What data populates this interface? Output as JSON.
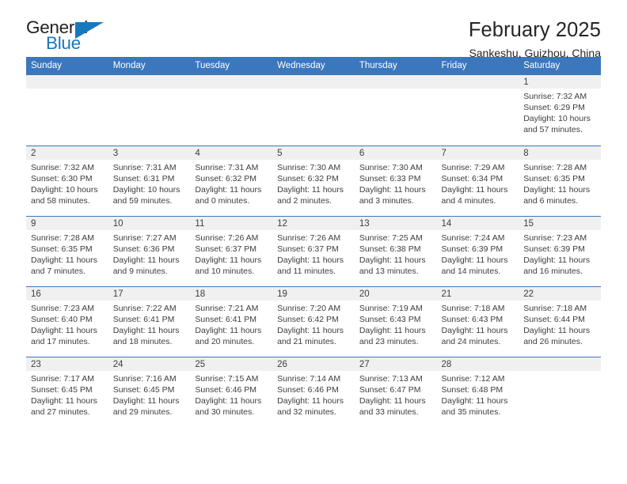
{
  "brand": {
    "name_part1": "General",
    "name_part2": "Blue",
    "accent_color": "#1878be"
  },
  "header": {
    "month_title": "February 2025",
    "location": "Sankeshu, Guizhou, China"
  },
  "calendar": {
    "header_bg": "#3b77bc",
    "weekdays": [
      "Sunday",
      "Monday",
      "Tuesday",
      "Wednesday",
      "Thursday",
      "Friday",
      "Saturday"
    ],
    "weeks": [
      [
        {
          "empty": true
        },
        {
          "empty": true
        },
        {
          "empty": true
        },
        {
          "empty": true
        },
        {
          "empty": true
        },
        {
          "empty": true
        },
        {
          "day": "1",
          "sunrise": "Sunrise: 7:32 AM",
          "sunset": "Sunset: 6:29 PM",
          "daylight": "Daylight: 10 hours and 57 minutes."
        }
      ],
      [
        {
          "day": "2",
          "sunrise": "Sunrise: 7:32 AM",
          "sunset": "Sunset: 6:30 PM",
          "daylight": "Daylight: 10 hours and 58 minutes."
        },
        {
          "day": "3",
          "sunrise": "Sunrise: 7:31 AM",
          "sunset": "Sunset: 6:31 PM",
          "daylight": "Daylight: 10 hours and 59 minutes."
        },
        {
          "day": "4",
          "sunrise": "Sunrise: 7:31 AM",
          "sunset": "Sunset: 6:32 PM",
          "daylight": "Daylight: 11 hours and 0 minutes."
        },
        {
          "day": "5",
          "sunrise": "Sunrise: 7:30 AM",
          "sunset": "Sunset: 6:32 PM",
          "daylight": "Daylight: 11 hours and 2 minutes."
        },
        {
          "day": "6",
          "sunrise": "Sunrise: 7:30 AM",
          "sunset": "Sunset: 6:33 PM",
          "daylight": "Daylight: 11 hours and 3 minutes."
        },
        {
          "day": "7",
          "sunrise": "Sunrise: 7:29 AM",
          "sunset": "Sunset: 6:34 PM",
          "daylight": "Daylight: 11 hours and 4 minutes."
        },
        {
          "day": "8",
          "sunrise": "Sunrise: 7:28 AM",
          "sunset": "Sunset: 6:35 PM",
          "daylight": "Daylight: 11 hours and 6 minutes."
        }
      ],
      [
        {
          "day": "9",
          "sunrise": "Sunrise: 7:28 AM",
          "sunset": "Sunset: 6:35 PM",
          "daylight": "Daylight: 11 hours and 7 minutes."
        },
        {
          "day": "10",
          "sunrise": "Sunrise: 7:27 AM",
          "sunset": "Sunset: 6:36 PM",
          "daylight": "Daylight: 11 hours and 9 minutes."
        },
        {
          "day": "11",
          "sunrise": "Sunrise: 7:26 AM",
          "sunset": "Sunset: 6:37 PM",
          "daylight": "Daylight: 11 hours and 10 minutes."
        },
        {
          "day": "12",
          "sunrise": "Sunrise: 7:26 AM",
          "sunset": "Sunset: 6:37 PM",
          "daylight": "Daylight: 11 hours and 11 minutes."
        },
        {
          "day": "13",
          "sunrise": "Sunrise: 7:25 AM",
          "sunset": "Sunset: 6:38 PM",
          "daylight": "Daylight: 11 hours and 13 minutes."
        },
        {
          "day": "14",
          "sunrise": "Sunrise: 7:24 AM",
          "sunset": "Sunset: 6:39 PM",
          "daylight": "Daylight: 11 hours and 14 minutes."
        },
        {
          "day": "15",
          "sunrise": "Sunrise: 7:23 AM",
          "sunset": "Sunset: 6:39 PM",
          "daylight": "Daylight: 11 hours and 16 minutes."
        }
      ],
      [
        {
          "day": "16",
          "sunrise": "Sunrise: 7:23 AM",
          "sunset": "Sunset: 6:40 PM",
          "daylight": "Daylight: 11 hours and 17 minutes."
        },
        {
          "day": "17",
          "sunrise": "Sunrise: 7:22 AM",
          "sunset": "Sunset: 6:41 PM",
          "daylight": "Daylight: 11 hours and 18 minutes."
        },
        {
          "day": "18",
          "sunrise": "Sunrise: 7:21 AM",
          "sunset": "Sunset: 6:41 PM",
          "daylight": "Daylight: 11 hours and 20 minutes."
        },
        {
          "day": "19",
          "sunrise": "Sunrise: 7:20 AM",
          "sunset": "Sunset: 6:42 PM",
          "daylight": "Daylight: 11 hours and 21 minutes."
        },
        {
          "day": "20",
          "sunrise": "Sunrise: 7:19 AM",
          "sunset": "Sunset: 6:43 PM",
          "daylight": "Daylight: 11 hours and 23 minutes."
        },
        {
          "day": "21",
          "sunrise": "Sunrise: 7:18 AM",
          "sunset": "Sunset: 6:43 PM",
          "daylight": "Daylight: 11 hours and 24 minutes."
        },
        {
          "day": "22",
          "sunrise": "Sunrise: 7:18 AM",
          "sunset": "Sunset: 6:44 PM",
          "daylight": "Daylight: 11 hours and 26 minutes."
        }
      ],
      [
        {
          "day": "23",
          "sunrise": "Sunrise: 7:17 AM",
          "sunset": "Sunset: 6:45 PM",
          "daylight": "Daylight: 11 hours and 27 minutes."
        },
        {
          "day": "24",
          "sunrise": "Sunrise: 7:16 AM",
          "sunset": "Sunset: 6:45 PM",
          "daylight": "Daylight: 11 hours and 29 minutes."
        },
        {
          "day": "25",
          "sunrise": "Sunrise: 7:15 AM",
          "sunset": "Sunset: 6:46 PM",
          "daylight": "Daylight: 11 hours and 30 minutes."
        },
        {
          "day": "26",
          "sunrise": "Sunrise: 7:14 AM",
          "sunset": "Sunset: 6:46 PM",
          "daylight": "Daylight: 11 hours and 32 minutes."
        },
        {
          "day": "27",
          "sunrise": "Sunrise: 7:13 AM",
          "sunset": "Sunset: 6:47 PM",
          "daylight": "Daylight: 11 hours and 33 minutes."
        },
        {
          "day": "28",
          "sunrise": "Sunrise: 7:12 AM",
          "sunset": "Sunset: 6:48 PM",
          "daylight": "Daylight: 11 hours and 35 minutes."
        },
        {
          "empty": true
        }
      ]
    ]
  }
}
